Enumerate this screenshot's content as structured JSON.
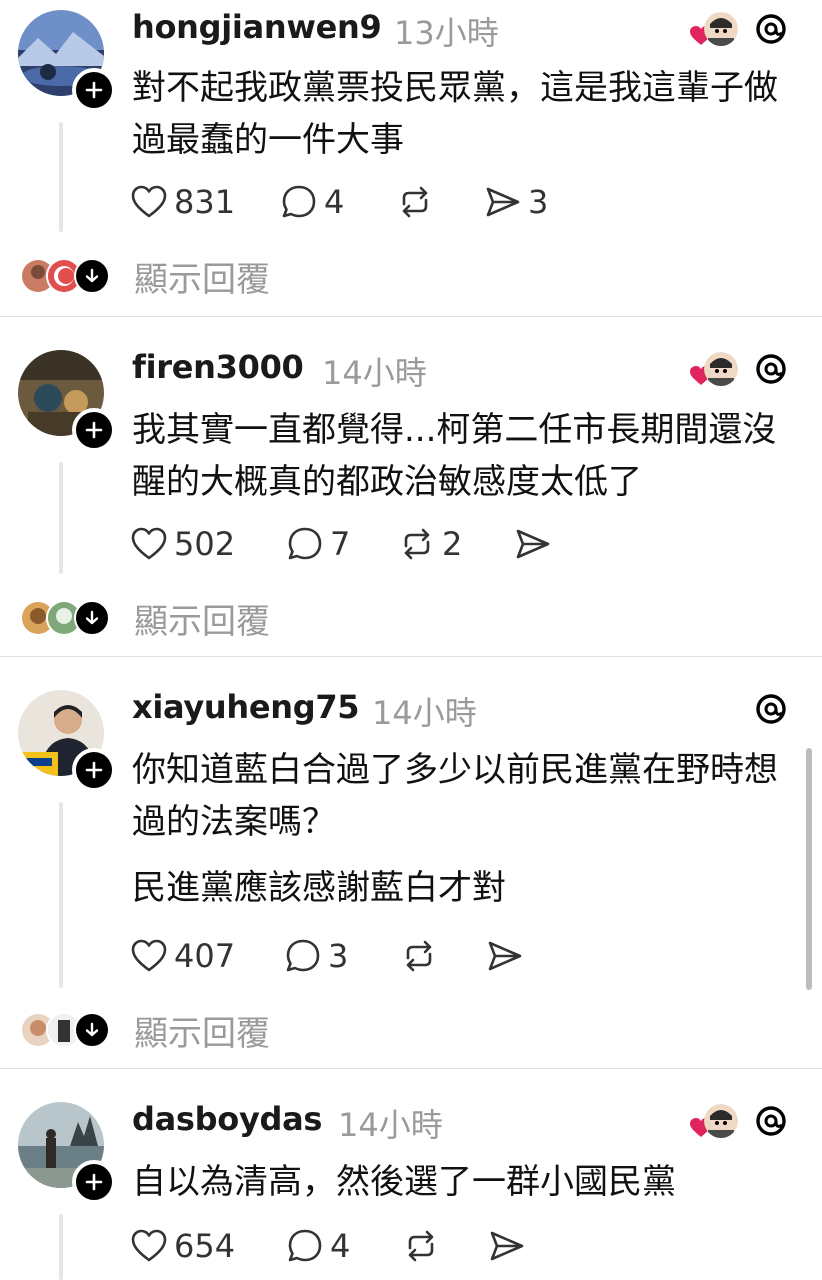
{
  "posts": [
    {
      "username": "hongjianwen9",
      "time": "13小時",
      "paragraphs": [
        "對不起我政黨票投民眾黨，這是我這輩子做過最蠢的一件大事"
      ],
      "likes": "831",
      "replies": "4",
      "reposts": "",
      "shares": "3",
      "show_replies": "顯示回覆"
    },
    {
      "username": "firen3000",
      "time": "14小時",
      "paragraphs": [
        "我其實一直都覺得...柯第二任市長期間還沒醒的大概真的都政治敏感度太低了"
      ],
      "likes": "502",
      "replies": "7",
      "reposts": "2",
      "shares": "",
      "show_replies": "顯示回覆"
    },
    {
      "username": "xiayuheng75",
      "time": "14小時",
      "paragraphs": [
        "你知道藍白合過了多少以前民進黨在野時想過的法案嗎？",
        "民進黨應該感謝藍白才對"
      ],
      "likes": "407",
      "replies": "3",
      "reposts": "",
      "shares": "",
      "show_replies": "顯示回覆"
    },
    {
      "username": "dasboydas",
      "time": "14小時",
      "paragraphs": [
        "自以為清高，然後選了一群小國民黨"
      ],
      "likes": "654",
      "replies": "4",
      "reposts": "",
      "shares": "",
      "show_replies": ""
    }
  ],
  "colors": {
    "text": "#111111",
    "muted": "#9a9a9a",
    "like_badge": "#e0245e",
    "divider": "#dedede"
  },
  "icons": [
    "heart-icon",
    "comment-icon",
    "repost-icon",
    "share-icon",
    "threads-logo-icon",
    "follow-plus-icon",
    "chevron-down-icon"
  ]
}
